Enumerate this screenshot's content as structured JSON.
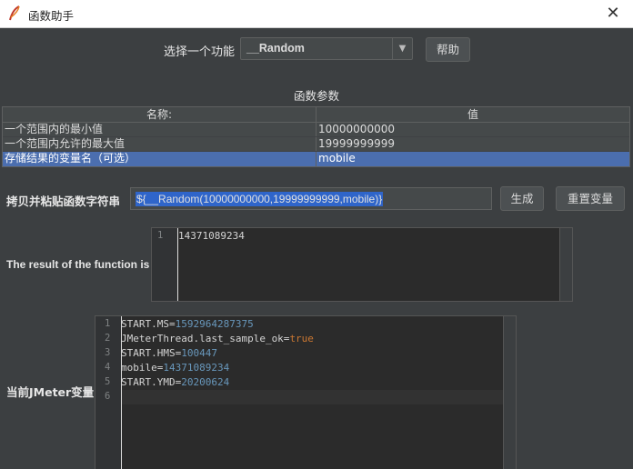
{
  "window": {
    "title": "函数助手",
    "close_glyph": "✕"
  },
  "function_select": {
    "label": "选择一个功能",
    "value": "__Random",
    "help_label": "帮助"
  },
  "params": {
    "title": "函数参数",
    "columns": [
      "名称:",
      "值"
    ],
    "rows": [
      {
        "name": "一个范围内的最小值",
        "value": "10000000000",
        "selected": false
      },
      {
        "name": "一个范围内允许的最大值",
        "value": "19999999999",
        "selected": false
      },
      {
        "name": "存储结果的变量名（可选）",
        "value": "mobile",
        "selected": true
      }
    ]
  },
  "copy": {
    "label": "拷贝并粘贴函数字符串",
    "value": "${__Random(10000000000,19999999999,mobile)}",
    "generate_label": "生成",
    "reset_label": "重置变量"
  },
  "result": {
    "label": "The result of the function is",
    "line_numbers": [
      "1"
    ],
    "lines": [
      "14371089234"
    ]
  },
  "jmeter_vars": {
    "label": "当前JMeter变量",
    "line_numbers": [
      "1",
      "2",
      "3",
      "4",
      "5",
      "6"
    ],
    "lines": [
      {
        "key": "START.MS=",
        "value": "1592964287375",
        "type": "num"
      },
      {
        "key": "JMeterThread.last_sample_ok=",
        "value": "true",
        "type": "kw"
      },
      {
        "key": "START.HMS=",
        "value": "100447",
        "type": "num"
      },
      {
        "key": "mobile=",
        "value": "14371089234",
        "type": "num"
      },
      {
        "key": "START.YMD=",
        "value": "20200624",
        "type": "num"
      },
      {
        "key": "",
        "value": "",
        "type": "num"
      }
    ]
  },
  "colors": {
    "background": "#3c3f41",
    "selection": "#4b6eaf",
    "number": "#6897bb",
    "keyword": "#cc7832"
  },
  "icons": {
    "app": "feather-icon",
    "close": "close-icon",
    "dropdown": "chevron-down-icon"
  }
}
